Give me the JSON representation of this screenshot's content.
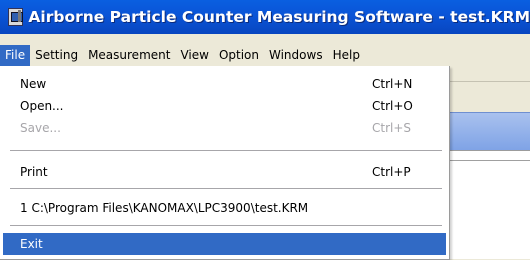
{
  "window": {
    "title": "Airborne Particle Counter Measuring Software - test.KRM"
  },
  "menubar": {
    "items": [
      "File",
      "Setting",
      "Measurement",
      "View",
      "Option",
      "Windows",
      "Help"
    ],
    "active": "File"
  },
  "file_menu": {
    "new_label": "New",
    "new_shortcut": "Ctrl+N",
    "open_label": "Open...",
    "open_shortcut": "Ctrl+O",
    "save_label": "Save...",
    "save_shortcut": "Ctrl+S",
    "print_label": "Print",
    "print_shortcut": "Ctrl+P",
    "recent_label": "1 C:\\Program Files\\KANOMAX\\LPC3900\\test.KRM",
    "exit_label": "Exit"
  },
  "colors": {
    "titlebar": "#0a55d8",
    "menu_highlight": "#316ac5",
    "disabled_text": "#a7a6aa"
  }
}
